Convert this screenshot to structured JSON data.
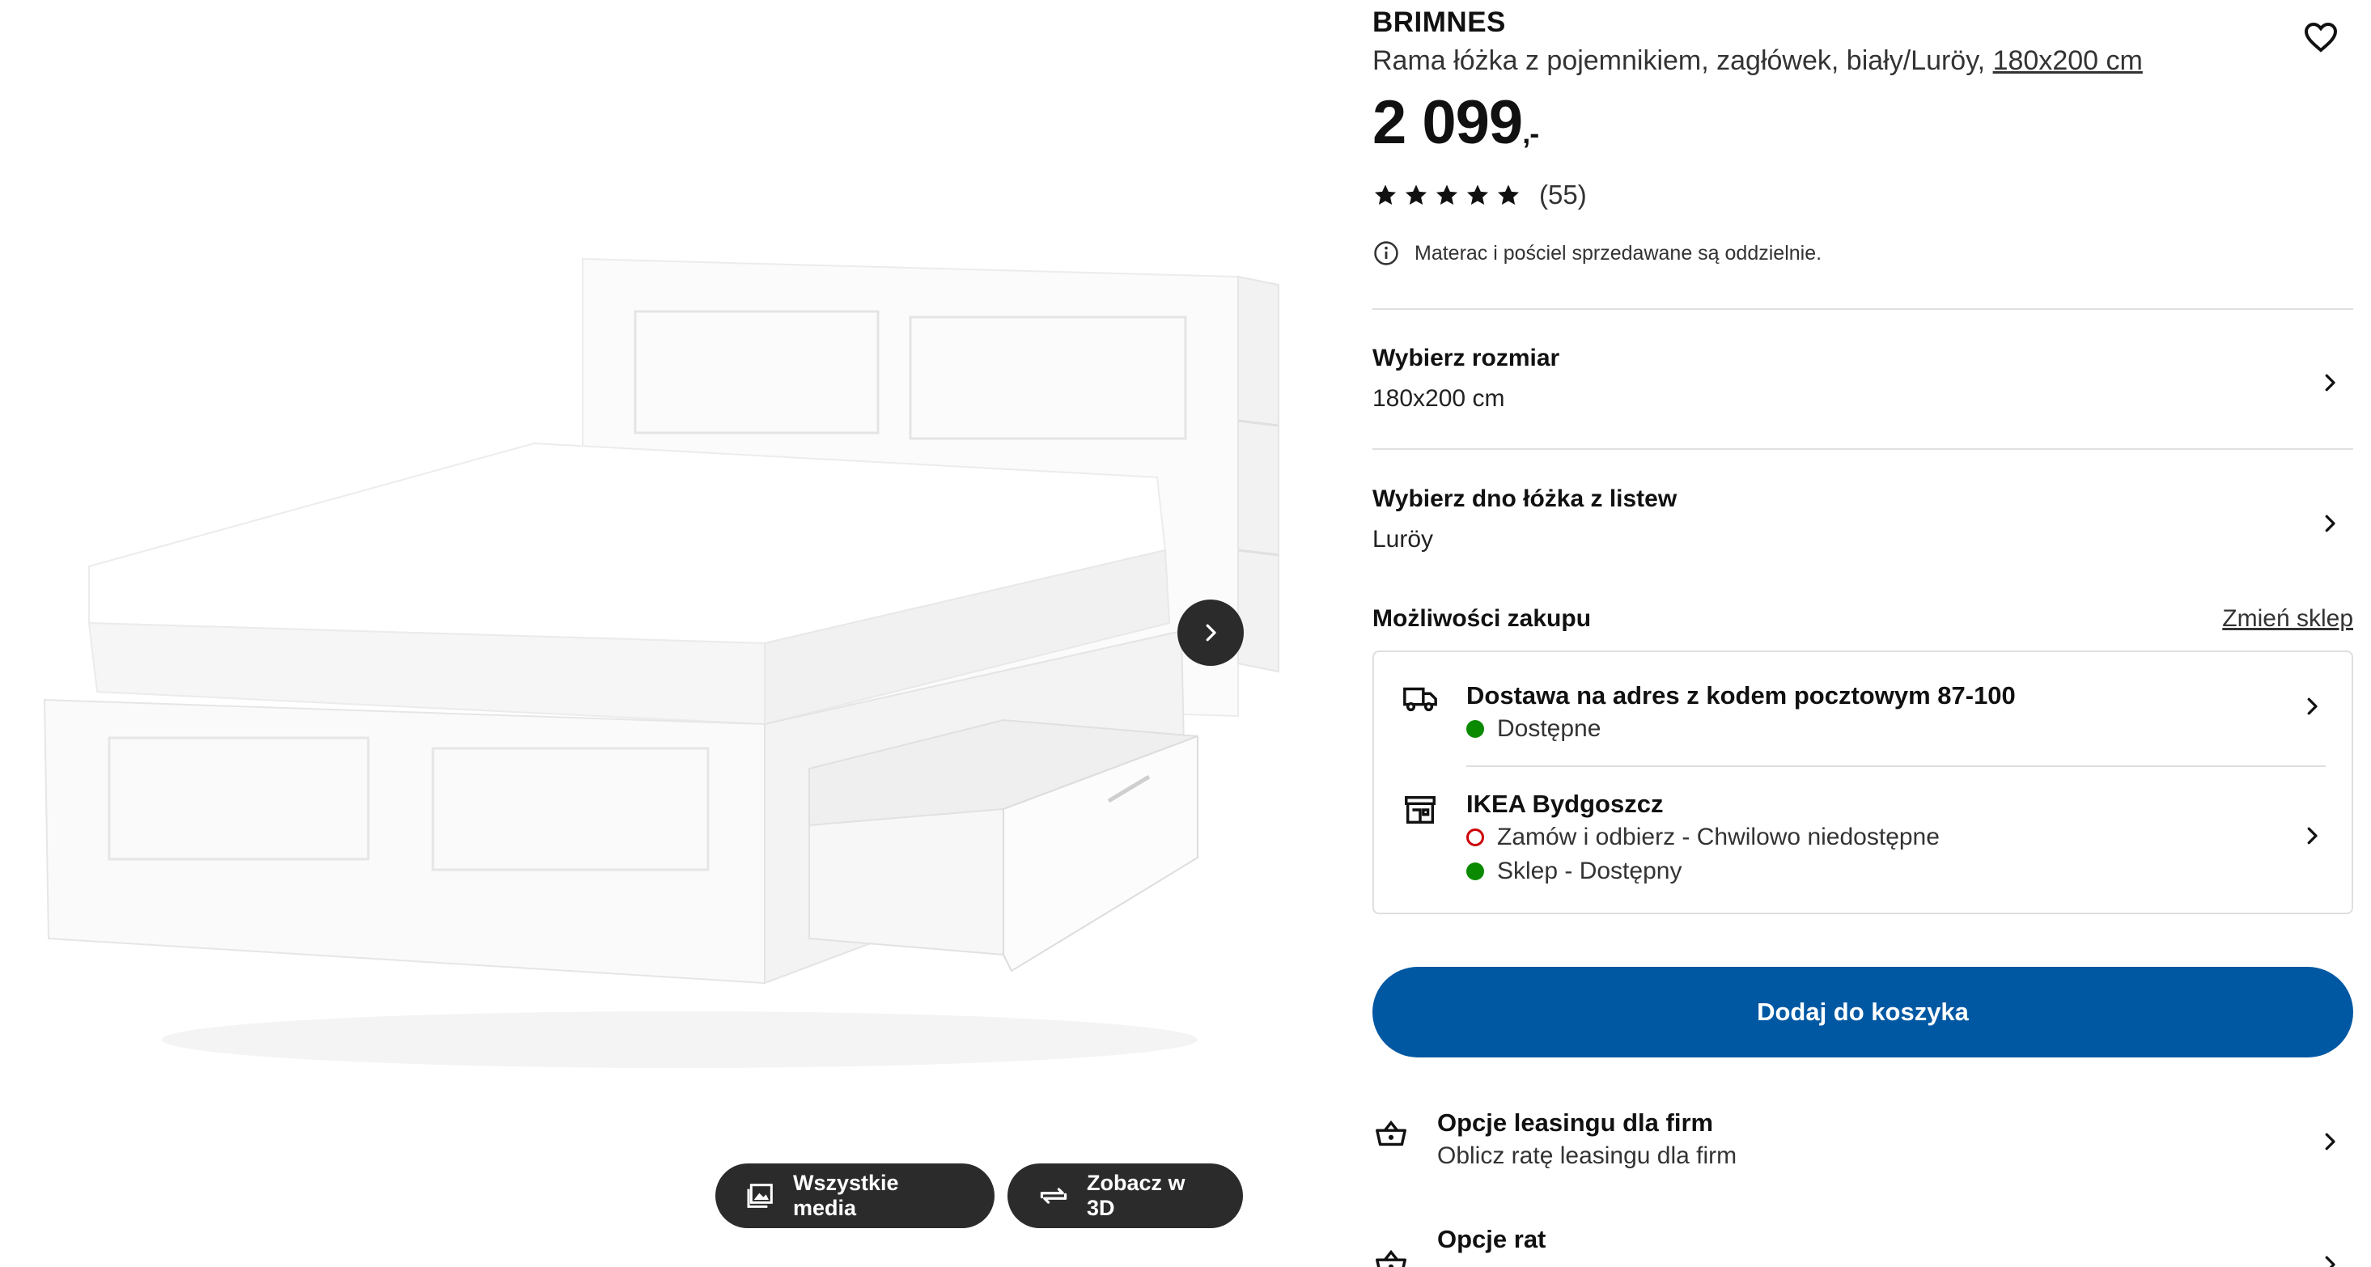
{
  "media": {
    "image_alt": "BRIMNES bed frame with storage and headboard, white",
    "next_icon": "chevron-right-icon",
    "buttons": {
      "all_media": "Wszystkie media",
      "view_3d": "Zobacz w 3D"
    }
  },
  "product": {
    "brand": "BRIMNES",
    "description": "Rama łóżka z pojemnikiem, zagłówek, biały/Luröy,",
    "size_link": "180x200 cm",
    "price_main": "2 099",
    "price_suffix": ",-",
    "rating": {
      "stars": 5,
      "count": "(55)"
    },
    "notice": "Materac i pościel sprzedawane są oddzielnie."
  },
  "options": {
    "size": {
      "label": "Wybierz rozmiar",
      "value": "180x200 cm"
    },
    "slatted_base": {
      "label": "Wybierz dno łóżka z listew",
      "value": "Luröy"
    }
  },
  "purchase": {
    "title": "Możliwości zakupu",
    "change_store": "Zmień sklep",
    "delivery": {
      "title": "Dostawa na adres z kodem pocztowym 87-100",
      "status": "Dostępne",
      "status_kind": "available"
    },
    "store": {
      "title": "IKEA Bydgoszcz",
      "click_collect": "Zamów i odbierz - Chwilowo niedostępne",
      "click_collect_kind": "unavailable",
      "in_store": "Sklep - Dostępny",
      "in_store_kind": "available"
    }
  },
  "cart": {
    "add_label": "Dodaj do koszyka"
  },
  "services": [
    {
      "title": "Opcje leasingu dla firm",
      "desc": "Oblicz ratę leasingu dla firm",
      "icon": "basket-icon"
    },
    {
      "title": "Opcje rat",
      "desc": "",
      "icon": "basket-icon"
    }
  ],
  "colors": {
    "primary_button": "#0058a3",
    "available": "#0a8a00",
    "unavailable": "#cc0008",
    "media_button": "#2b2b2b"
  }
}
